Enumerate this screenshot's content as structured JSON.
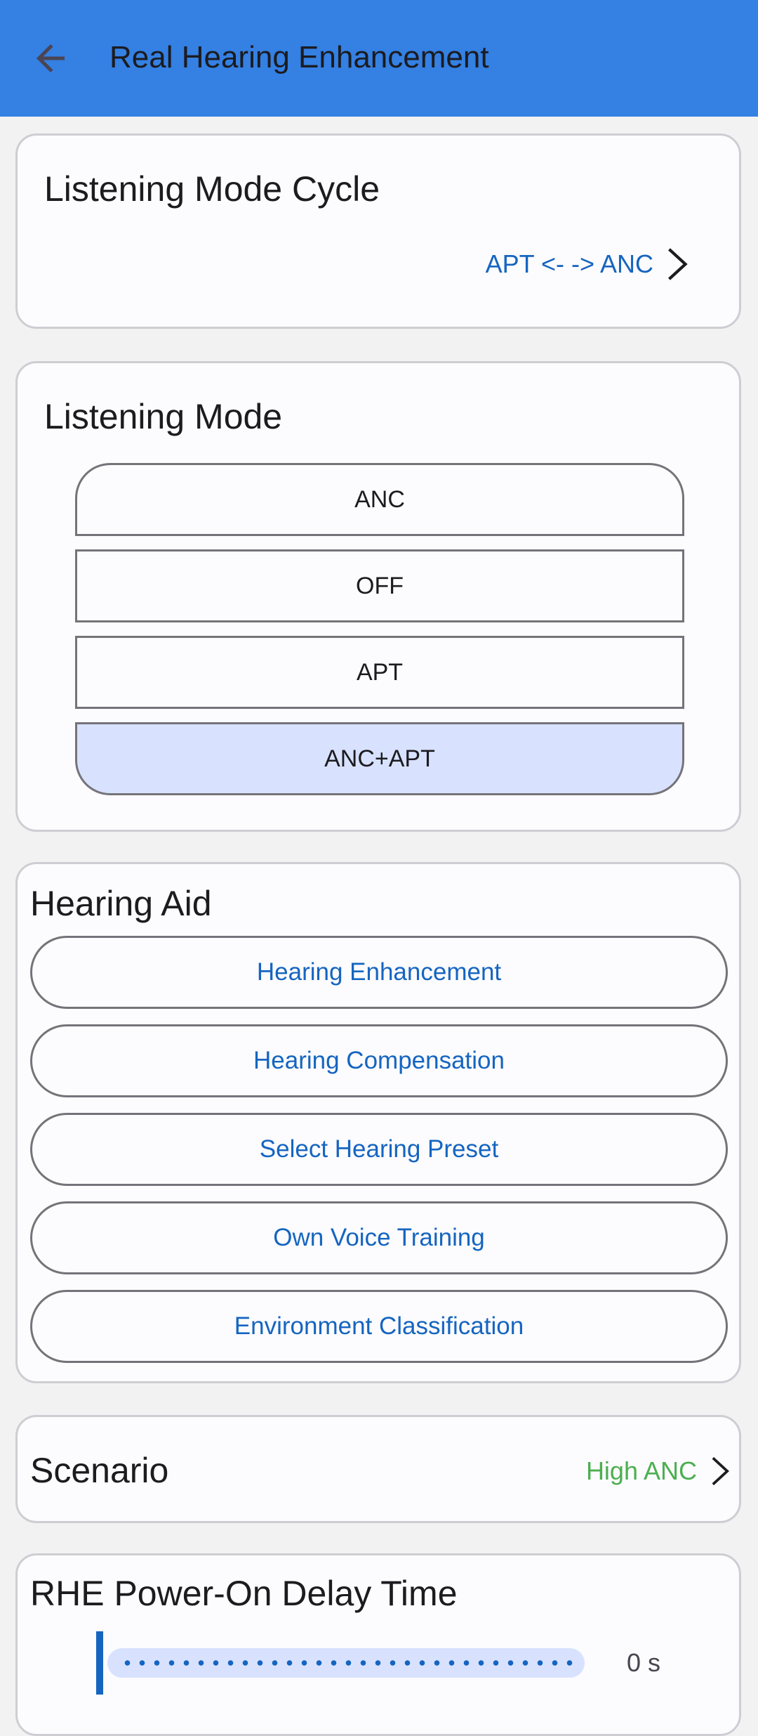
{
  "appbar": {
    "title": "Real Hearing Enhancement",
    "back_icon": "arrow-left-icon",
    "background": "#3480e3"
  },
  "listening_mode_cycle": {
    "title": "Listening Mode Cycle",
    "value": "APT <- -> ANC",
    "value_color": "#1565c0",
    "chevron_icon": "chevron-right-icon"
  },
  "listening_mode": {
    "title": "Listening Mode",
    "options": [
      {
        "label": "ANC",
        "selected": false
      },
      {
        "label": "OFF",
        "selected": false
      },
      {
        "label": "APT",
        "selected": false
      },
      {
        "label": "ANC+APT",
        "selected": true
      }
    ],
    "selected_color": "#d8e2ff"
  },
  "hearing_aid": {
    "title": "Hearing Aid",
    "buttons": [
      "Hearing Enhancement",
      "Hearing Compensation",
      "Select Hearing Preset",
      "Own Voice Training",
      "Environment Classification"
    ]
  },
  "scenario": {
    "title": "Scenario",
    "value": "High ANC",
    "value_color": "#4caf50",
    "chevron_icon": "chevron-right-icon"
  },
  "power_on_delay": {
    "title": "RHE Power-On Delay Time",
    "value": "0 s",
    "slider_fraction": 0.0
  }
}
